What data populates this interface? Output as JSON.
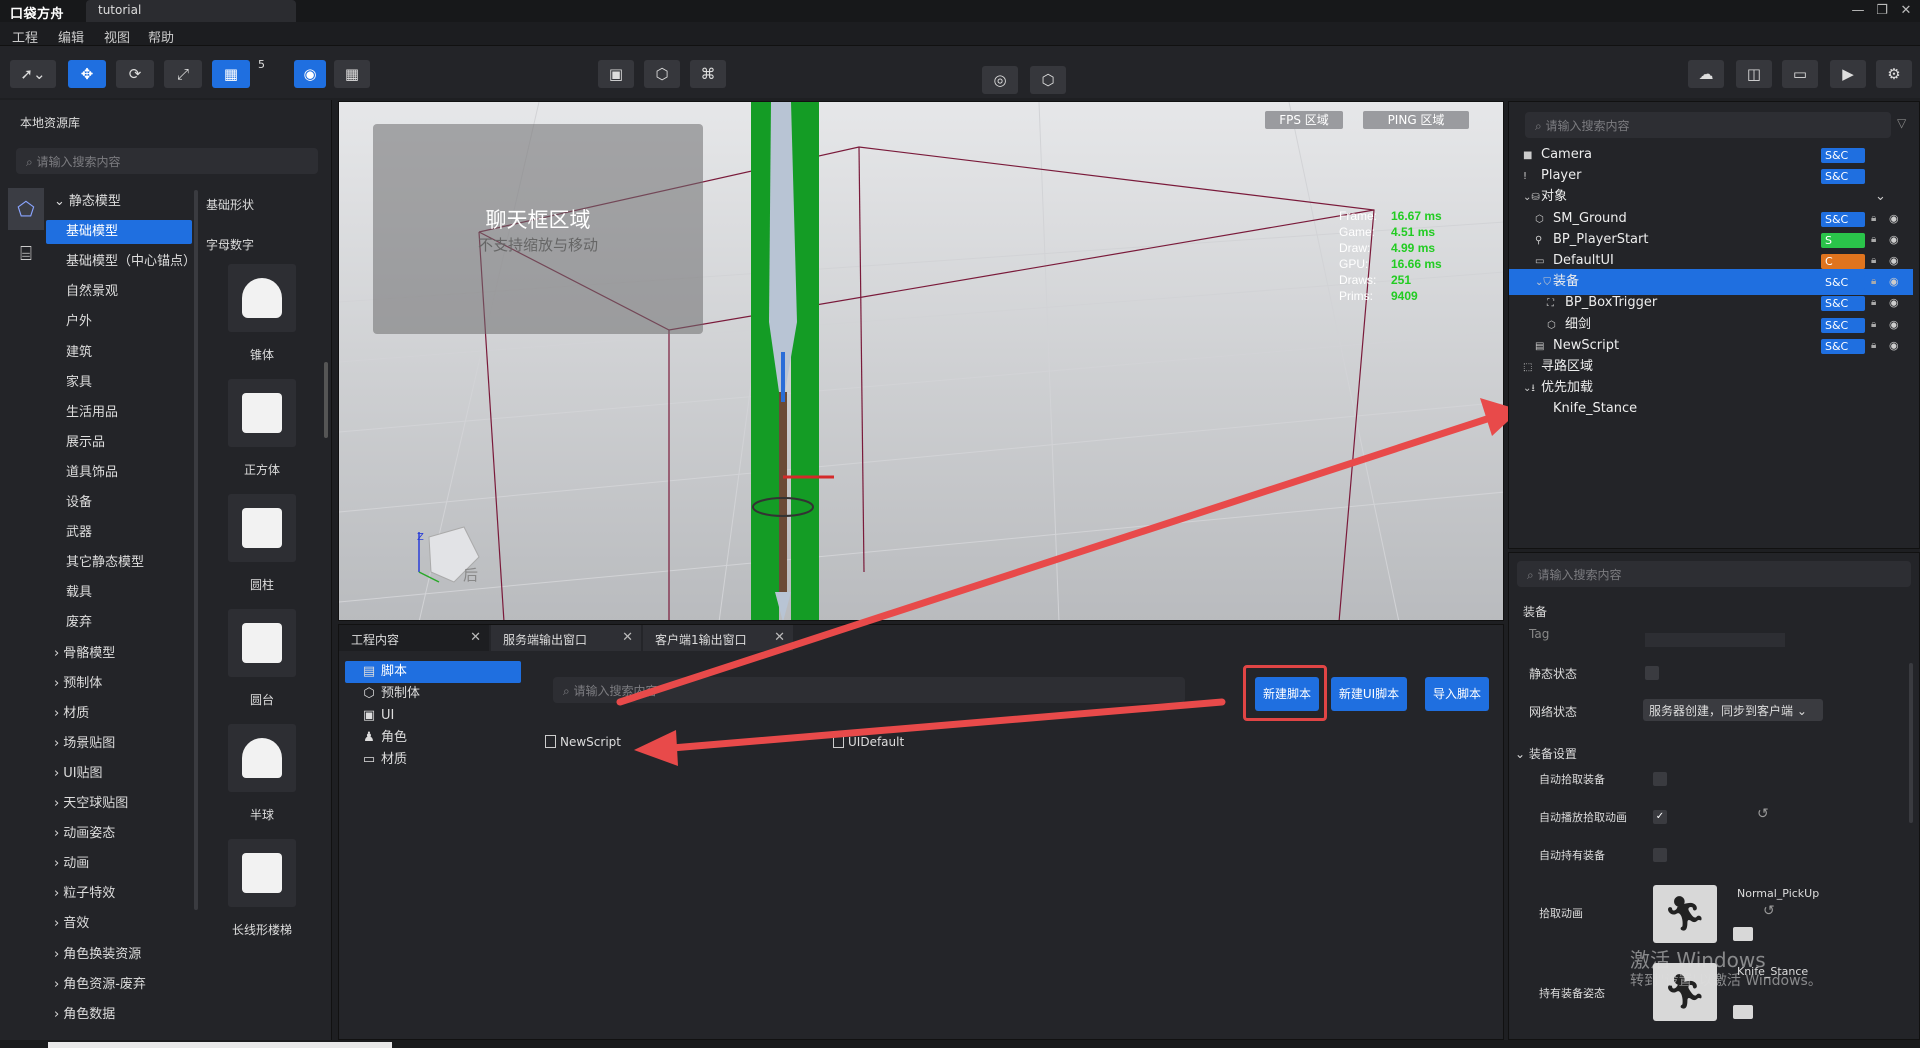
{
  "app": {
    "logo": "口袋方舟",
    "doc_tab": "tutorial",
    "win_min": "—",
    "win_max": "❐",
    "win_close": "✕"
  },
  "menu": [
    "工程",
    "编辑",
    "视图",
    "帮助"
  ],
  "toolbar": {
    "grid_value": "5"
  },
  "left": {
    "title": "本地资源库",
    "search_placeholder": "请输入搜索内容",
    "categories": [
      {
        "label": "静态模型",
        "prefix": "⌄"
      },
      {
        "label": "基础模型",
        "prefix": "",
        "active": true
      },
      {
        "label": "基础模型（中心锚点）",
        "prefix": ""
      },
      {
        "label": "自然景观",
        "prefix": ""
      },
      {
        "label": "户外",
        "prefix": ""
      },
      {
        "label": "建筑",
        "prefix": ""
      },
      {
        "label": "家具",
        "prefix": ""
      },
      {
        "label": "生活用品",
        "prefix": ""
      },
      {
        "label": "展示品",
        "prefix": ""
      },
      {
        "label": "道具饰品",
        "prefix": ""
      },
      {
        "label": "设备",
        "prefix": ""
      },
      {
        "label": "武器",
        "prefix": ""
      },
      {
        "label": "其它静态模型",
        "prefix": ""
      },
      {
        "label": "载具",
        "prefix": ""
      },
      {
        "label": "废弃",
        "prefix": ""
      },
      {
        "label": "骨骼模型",
        "prefix": "›"
      },
      {
        "label": "预制体",
        "prefix": "›"
      },
      {
        "label": "材质",
        "prefix": "›"
      },
      {
        "label": "场景贴图",
        "prefix": "›"
      },
      {
        "label": "UI贴图",
        "prefix": "›"
      },
      {
        "label": "天空球贴图",
        "prefix": "›"
      },
      {
        "label": "动画姿态",
        "prefix": "›"
      },
      {
        "label": "动画",
        "prefix": "›"
      },
      {
        "label": "粒子特效",
        "prefix": "›"
      },
      {
        "label": "音效",
        "prefix": "›"
      },
      {
        "label": "角色换装资源",
        "prefix": "›"
      },
      {
        "label": "角色资源-废弃",
        "prefix": "›"
      },
      {
        "label": "角色数据",
        "prefix": "›"
      }
    ],
    "shapes_title": "基础形状",
    "shapes_sub": "字母数字",
    "shapes": [
      "锥体",
      "正方体",
      "圆柱",
      "圆台",
      "半球",
      "长线形楼梯"
    ]
  },
  "viewport": {
    "chat_title": "聊天框区域",
    "chat_sub": "不支持缩放与移动",
    "fps_label": "FPS 区域",
    "ping_label": "PING 区域",
    "stats": [
      {
        "label": "Frame:",
        "value": "16.67 ms"
      },
      {
        "label": "Game:",
        "value": "4.51 ms"
      },
      {
        "label": "Draw:",
        "value": "4.99 ms"
      },
      {
        "label": "GPU:",
        "value": "16.66 ms"
      },
      {
        "label": "Draws:",
        "value": "251"
      },
      {
        "label": "Prims:",
        "value": "9409"
      }
    ],
    "axis_z": "Z",
    "cube_face": "后"
  },
  "bottom": {
    "tabs": [
      "工程内容",
      "服务端输出窗口",
      "客户端1输出窗口"
    ],
    "tree": [
      {
        "label": "脚本",
        "icon": "▤",
        "active": true
      },
      {
        "label": "预制体",
        "icon": "⬡"
      },
      {
        "label": "UI",
        "icon": "▣"
      },
      {
        "label": "角色",
        "icon": "♟"
      },
      {
        "label": "材质",
        "icon": "▭"
      }
    ],
    "search_placeholder": "请输入搜索内容",
    "buttons": {
      "new_script": "新建脚本",
      "new_ui_script": "新建UI脚本",
      "import_script": "导入脚本"
    },
    "files": [
      "NewScript",
      "UIDefault"
    ]
  },
  "right": {
    "search_placeholder": "请输入搜索内容",
    "rows": [
      {
        "label": "Camera",
        "indent": 0,
        "icon": "■",
        "badge": "S&C",
        "badge_type": "sc",
        "lock": false
      },
      {
        "label": "Player",
        "indent": 0,
        "icon": "!",
        "badge": "S&C",
        "badge_type": "sc",
        "lock": false
      },
      {
        "label": "对象",
        "indent": 0,
        "icon": "⌄⛁",
        "badge": "",
        "badge_type": "",
        "lock": false,
        "chev": "⌄"
      },
      {
        "label": "SM_Ground",
        "indent": 1,
        "icon": "⬡",
        "badge": "S&C",
        "badge_type": "sc",
        "lock": true
      },
      {
        "label": "BP_PlayerStart",
        "indent": 1,
        "icon": "⚲",
        "badge": "S",
        "badge_type": "s",
        "lock": true
      },
      {
        "label": "DefaultUI",
        "indent": 1,
        "icon": "▭",
        "badge": "C",
        "badge_type": "c",
        "lock": true
      },
      {
        "label": "装备",
        "indent": 1,
        "icon": "⌄⛉",
        "badge": "S&C",
        "badge_type": "sc",
        "lock": true,
        "selected": true
      },
      {
        "label": "BP_BoxTrigger",
        "indent": 2,
        "icon": "⛶",
        "badge": "S&C",
        "badge_type": "sc",
        "lock": true
      },
      {
        "label": "细剑",
        "indent": 2,
        "icon": "⬡",
        "badge": "S&C",
        "badge_type": "sc",
        "lock": true
      },
      {
        "label": "NewScript",
        "indent": 1,
        "icon": "▤",
        "badge": "S&C",
        "badge_type": "sc",
        "lock": true
      },
      {
        "label": "寻路区域",
        "indent": 0,
        "icon": "⬚",
        "badge": "",
        "badge_type": "",
        "lock": false
      },
      {
        "label": "优先加载",
        "indent": 0,
        "icon": "⌄⭳",
        "badge": "",
        "badge_type": "",
        "lock": false
      },
      {
        "label": "Knife_Stance",
        "indent": 1,
        "icon": "",
        "badge": "",
        "badge_type": "",
        "lock": false
      }
    ]
  },
  "props": {
    "search_placeholder": "请输入搜索内容",
    "header": "装备",
    "tag_label": "Tag",
    "static_label": "静态状态",
    "net_label": "网络状态",
    "net_value": "服务器创建，同步到客户端",
    "section": "装备设置",
    "auto_pickup": "自动拾取装备",
    "auto_play_pickup_anim": "自动播放拾取动画",
    "auto_hold": "自动持有装备",
    "pickup_anim_label": "拾取动画",
    "pickup_anim_value": "Normal_PickUp",
    "hold_pose_label": "持有装备姿态",
    "hold_pose_value": "Knife_Stance"
  },
  "watermark": {
    "line1": "激活 Windows",
    "line2": "转到\"设置\"以激活 Windows。"
  },
  "colors": {
    "accent": "#1f6fe0",
    "highlight": "#e04545",
    "stat_green": "#22cc22"
  }
}
